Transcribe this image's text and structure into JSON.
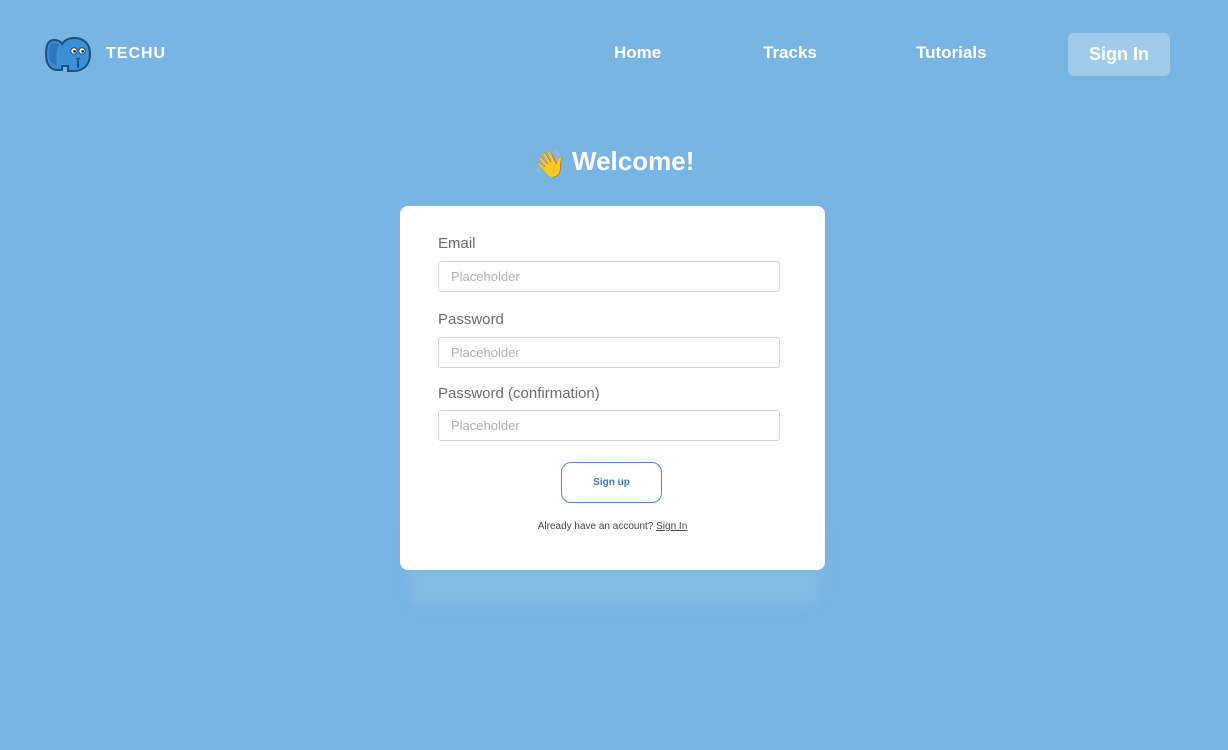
{
  "header": {
    "brand": "TECHU",
    "logo_icon": "blue-elephant-mascot",
    "nav": {
      "home": "Home",
      "tracks": "Tracks",
      "tutorials": "Tutorials"
    },
    "signin_label": "Sign In"
  },
  "welcome": {
    "emoji": "👋",
    "title": "Welcome!"
  },
  "form": {
    "email": {
      "label": "Email",
      "placeholder": "Placeholder"
    },
    "password": {
      "label": "Password",
      "placeholder": "Placeholder"
    },
    "password_confirmation": {
      "label": "Password (confirmation)",
      "placeholder": "Placeholder"
    },
    "submit_label": "Sign up",
    "account_prompt": "Already have an account?",
    "signin_link": "Sign In"
  },
  "colors": {
    "background": "#78b5e2",
    "card": "#ffffff",
    "signin_button": "#a0cbeb",
    "accent": "#4a88d8"
  }
}
